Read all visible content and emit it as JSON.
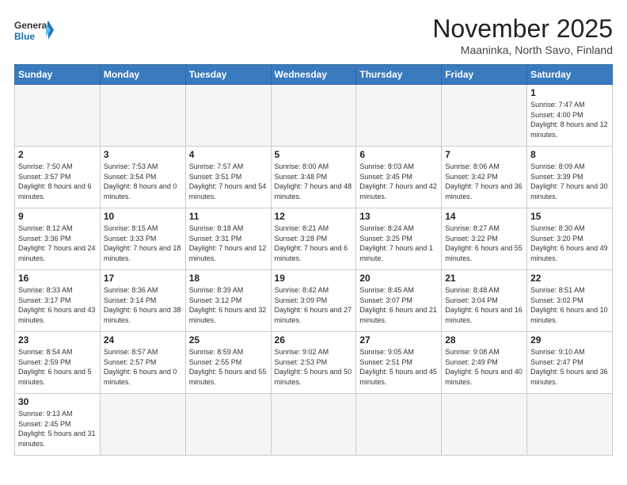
{
  "header": {
    "logo_general": "General",
    "logo_blue": "Blue",
    "title": "November 2025",
    "subtitle": "Maaninka, North Savo, Finland"
  },
  "weekdays": [
    "Sunday",
    "Monday",
    "Tuesday",
    "Wednesday",
    "Thursday",
    "Friday",
    "Saturday"
  ],
  "weeks": [
    [
      {
        "day": "",
        "info": "",
        "empty": true
      },
      {
        "day": "",
        "info": "",
        "empty": true
      },
      {
        "day": "",
        "info": "",
        "empty": true
      },
      {
        "day": "",
        "info": "",
        "empty": true
      },
      {
        "day": "",
        "info": "",
        "empty": true
      },
      {
        "day": "",
        "info": "",
        "empty": true
      },
      {
        "day": "1",
        "info": "Sunrise: 7:47 AM\nSunset: 4:00 PM\nDaylight: 8 hours\nand 12 minutes.",
        "empty": false
      }
    ],
    [
      {
        "day": "2",
        "info": "Sunrise: 7:50 AM\nSunset: 3:57 PM\nDaylight: 8 hours\nand 6 minutes.",
        "empty": false
      },
      {
        "day": "3",
        "info": "Sunrise: 7:53 AM\nSunset: 3:54 PM\nDaylight: 8 hours\nand 0 minutes.",
        "empty": false
      },
      {
        "day": "4",
        "info": "Sunrise: 7:57 AM\nSunset: 3:51 PM\nDaylight: 7 hours\nand 54 minutes.",
        "empty": false
      },
      {
        "day": "5",
        "info": "Sunrise: 8:00 AM\nSunset: 3:48 PM\nDaylight: 7 hours\nand 48 minutes.",
        "empty": false
      },
      {
        "day": "6",
        "info": "Sunrise: 8:03 AM\nSunset: 3:45 PM\nDaylight: 7 hours\nand 42 minutes.",
        "empty": false
      },
      {
        "day": "7",
        "info": "Sunrise: 8:06 AM\nSunset: 3:42 PM\nDaylight: 7 hours\nand 36 minutes.",
        "empty": false
      },
      {
        "day": "8",
        "info": "Sunrise: 8:09 AM\nSunset: 3:39 PM\nDaylight: 7 hours\nand 30 minutes.",
        "empty": false
      }
    ],
    [
      {
        "day": "9",
        "info": "Sunrise: 8:12 AM\nSunset: 3:36 PM\nDaylight: 7 hours\nand 24 minutes.",
        "empty": false
      },
      {
        "day": "10",
        "info": "Sunrise: 8:15 AM\nSunset: 3:33 PM\nDaylight: 7 hours\nand 18 minutes.",
        "empty": false
      },
      {
        "day": "11",
        "info": "Sunrise: 8:18 AM\nSunset: 3:31 PM\nDaylight: 7 hours\nand 12 minutes.",
        "empty": false
      },
      {
        "day": "12",
        "info": "Sunrise: 8:21 AM\nSunset: 3:28 PM\nDaylight: 7 hours\nand 6 minutes.",
        "empty": false
      },
      {
        "day": "13",
        "info": "Sunrise: 8:24 AM\nSunset: 3:25 PM\nDaylight: 7 hours\nand 1 minute.",
        "empty": false
      },
      {
        "day": "14",
        "info": "Sunrise: 8:27 AM\nSunset: 3:22 PM\nDaylight: 6 hours\nand 55 minutes.",
        "empty": false
      },
      {
        "day": "15",
        "info": "Sunrise: 8:30 AM\nSunset: 3:20 PM\nDaylight: 6 hours\nand 49 minutes.",
        "empty": false
      }
    ],
    [
      {
        "day": "16",
        "info": "Sunrise: 8:33 AM\nSunset: 3:17 PM\nDaylight: 6 hours\nand 43 minutes.",
        "empty": false
      },
      {
        "day": "17",
        "info": "Sunrise: 8:36 AM\nSunset: 3:14 PM\nDaylight: 6 hours\nand 38 minutes.",
        "empty": false
      },
      {
        "day": "18",
        "info": "Sunrise: 8:39 AM\nSunset: 3:12 PM\nDaylight: 6 hours\nand 32 minutes.",
        "empty": false
      },
      {
        "day": "19",
        "info": "Sunrise: 8:42 AM\nSunset: 3:09 PM\nDaylight: 6 hours\nand 27 minutes.",
        "empty": false
      },
      {
        "day": "20",
        "info": "Sunrise: 8:45 AM\nSunset: 3:07 PM\nDaylight: 6 hours\nand 21 minutes.",
        "empty": false
      },
      {
        "day": "21",
        "info": "Sunrise: 8:48 AM\nSunset: 3:04 PM\nDaylight: 6 hours\nand 16 minutes.",
        "empty": false
      },
      {
        "day": "22",
        "info": "Sunrise: 8:51 AM\nSunset: 3:02 PM\nDaylight: 6 hours\nand 10 minutes.",
        "empty": false
      }
    ],
    [
      {
        "day": "23",
        "info": "Sunrise: 8:54 AM\nSunset: 2:59 PM\nDaylight: 6 hours\nand 5 minutes.",
        "empty": false
      },
      {
        "day": "24",
        "info": "Sunrise: 8:57 AM\nSunset: 2:57 PM\nDaylight: 6 hours\nand 0 minutes.",
        "empty": false
      },
      {
        "day": "25",
        "info": "Sunrise: 8:59 AM\nSunset: 2:55 PM\nDaylight: 5 hours\nand 55 minutes.",
        "empty": false
      },
      {
        "day": "26",
        "info": "Sunrise: 9:02 AM\nSunset: 2:53 PM\nDaylight: 5 hours\nand 50 minutes.",
        "empty": false
      },
      {
        "day": "27",
        "info": "Sunrise: 9:05 AM\nSunset: 2:51 PM\nDaylight: 5 hours\nand 45 minutes.",
        "empty": false
      },
      {
        "day": "28",
        "info": "Sunrise: 9:08 AM\nSunset: 2:49 PM\nDaylight: 5 hours\nand 40 minutes.",
        "empty": false
      },
      {
        "day": "29",
        "info": "Sunrise: 9:10 AM\nSunset: 2:47 PM\nDaylight: 5 hours\nand 36 minutes.",
        "empty": false
      }
    ],
    [
      {
        "day": "30",
        "info": "Sunrise: 9:13 AM\nSunset: 2:45 PM\nDaylight: 5 hours\nand 31 minutes.",
        "empty": false
      },
      {
        "day": "",
        "info": "",
        "empty": true
      },
      {
        "day": "",
        "info": "",
        "empty": true
      },
      {
        "day": "",
        "info": "",
        "empty": true
      },
      {
        "day": "",
        "info": "",
        "empty": true
      },
      {
        "day": "",
        "info": "",
        "empty": true
      },
      {
        "day": "",
        "info": "",
        "empty": true
      }
    ]
  ]
}
